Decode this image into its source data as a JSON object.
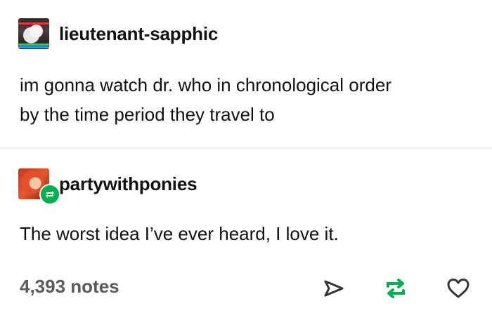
{
  "post": {
    "original": {
      "username": "lieutenant-sapphic",
      "text_lines": [
        "im gonna watch dr. who in chronological order",
        "by the time period they travel to"
      ]
    },
    "reblog": {
      "username": "partywithponies",
      "text": "The worst idea I’ve ever heard, I love it.",
      "badge_icon": "reblog-icon"
    },
    "footer": {
      "notes": "4,393 notes",
      "actions": [
        "share-icon",
        "reblog-icon",
        "heart-icon"
      ]
    }
  },
  "colors": {
    "accent_green": "#00b050",
    "notes_gray": "#5a5a5a",
    "icon_dark": "#333333"
  }
}
